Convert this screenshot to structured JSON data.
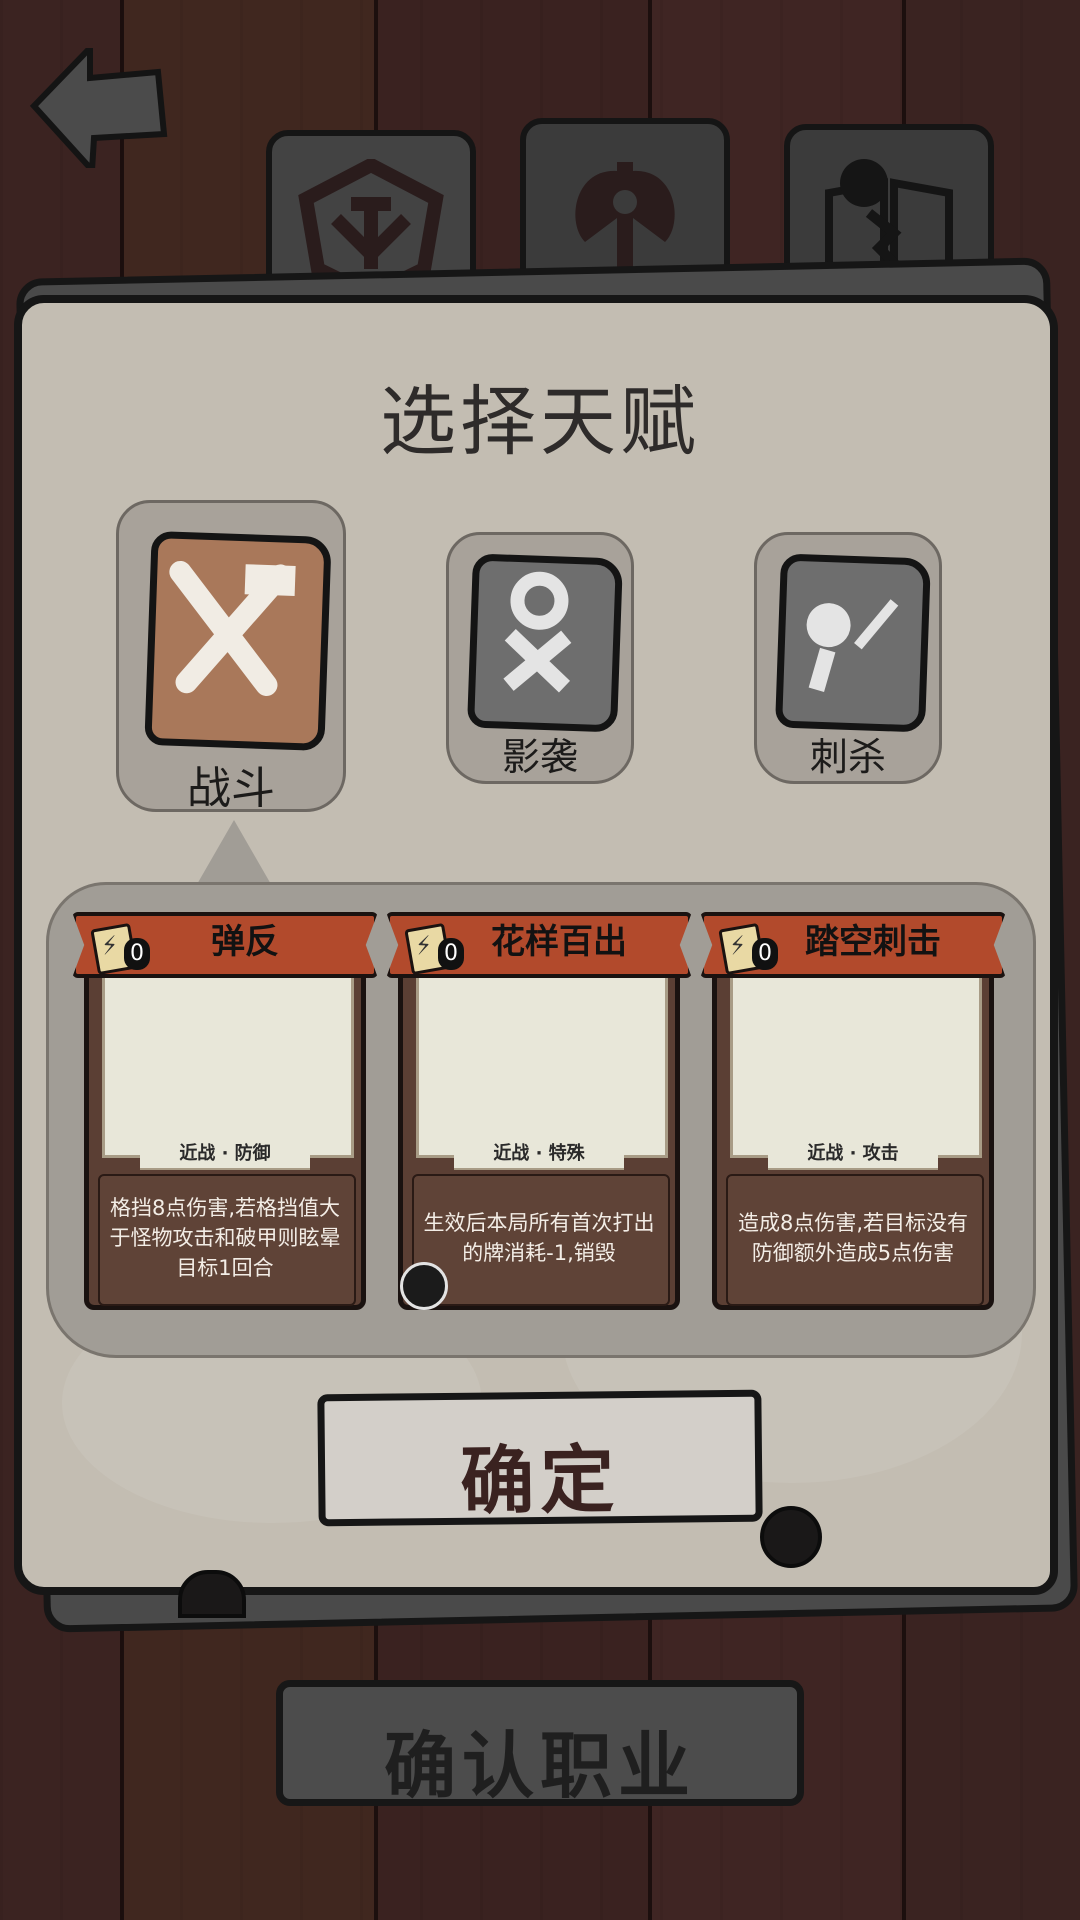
{
  "header": {
    "back_icon": "back-arrow-icon",
    "tabs": [
      {
        "icon": "crest-emblem-icon",
        "active": true
      },
      {
        "icon": "battle-axe-icon",
        "active": false
      },
      {
        "icon": "spellbook-icon",
        "active": false
      }
    ]
  },
  "panel": {
    "title": "选择天赋",
    "talents": [
      {
        "label": "战斗",
        "icon": "crossed-swords-icon",
        "selected": true
      },
      {
        "label": "影袭",
        "icon": "shadow-figure-icon",
        "selected": false
      },
      {
        "label": "刺杀",
        "icon": "dagger-strike-icon",
        "selected": false
      }
    ],
    "cards": [
      {
        "name": "弹反",
        "cost": "0",
        "tag": "近战 · 防御",
        "desc": "格挡8点伤害,若格挡值大于怪物攻击和破甲则眩晕目标1回合"
      },
      {
        "name": "花样百出",
        "cost": "0",
        "tag": "近战 · 特殊",
        "desc": "生效后本局所有首次打出的牌消耗-1,销毁"
      },
      {
        "name": "踏空刺击",
        "cost": "0",
        "tag": "近战 · 攻击",
        "desc": "造成8点伤害,若目标没有防御额外造成5点伤害"
      }
    ],
    "confirm_label": "确定"
  },
  "footer": {
    "confirm_job_label": "确认职业"
  },
  "colors": {
    "wood_bg": "#3a2422",
    "panel": "#c3bdb2",
    "ribbon": "#b24a2c",
    "selected_rune": "#a9785a",
    "unselected_rune": "#6e6e6e"
  }
}
